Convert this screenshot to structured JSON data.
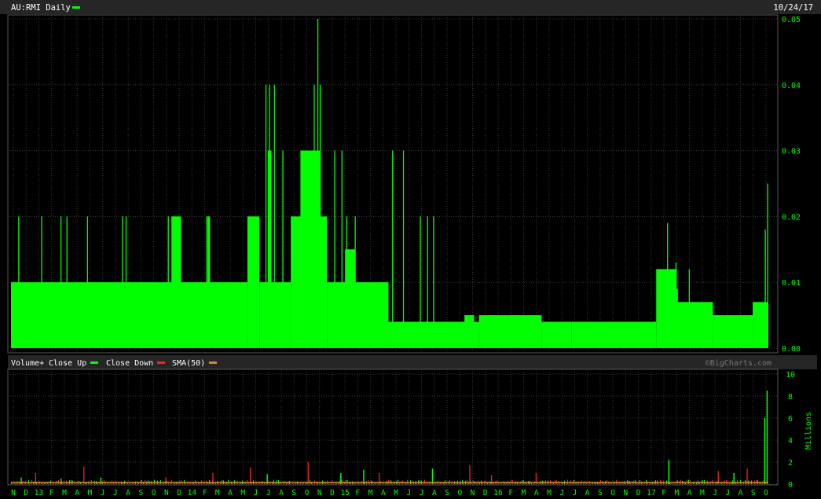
{
  "header": {
    "symbol_label": "AU:RMI Daily",
    "date": "10/24/17",
    "legend_color": "#00ff00"
  },
  "volume_header": {
    "label": "Volume+",
    "close_up_label": "Close Up",
    "close_down_label": "Close Down",
    "sma_label": "SMA(50)",
    "watermark": "©BigCharts.com",
    "up_color": "#00ff00",
    "down_color": "#ff2020",
    "sma_color": "#d08a2a"
  },
  "colors": {
    "background": "#000000",
    "grid": "#3a3a3a",
    "axis_text": "#00ff00",
    "frame": "#9a9a9a",
    "panel_bar": "#2e2e2e"
  },
  "chart_data": [
    {
      "type": "area",
      "name": "price",
      "yticks": [
        "0.05",
        "0.04",
        "0.03",
        "0.02",
        "0.01",
        "0.00"
      ],
      "ylim": [
        0,
        0.05
      ],
      "xlim": [
        0,
        62.8
      ],
      "grid": true,
      "baseline_segments": [
        [
          0,
          19.6,
          0.01
        ],
        [
          19.6,
          20.6,
          0.02
        ],
        [
          20.6,
          23.2,
          0.01
        ],
        [
          23.2,
          26.2,
          0.02
        ],
        [
          26.2,
          31.3,
          0.01
        ],
        [
          31.3,
          38.8,
          0.004
        ],
        [
          38.8,
          44.0,
          0.005
        ],
        [
          44.0,
          46.5,
          0.004
        ],
        [
          46.5,
          53.5,
          0.004
        ],
        [
          53.5,
          55.2,
          0.012
        ],
        [
          55.2,
          58.2,
          0.007
        ],
        [
          58.2,
          61.5,
          0.005
        ],
        [
          61.5,
          62.8,
          0.007
        ]
      ],
      "step_segments": [
        [
          13.3,
          14.1,
          0.02
        ],
        [
          16.3,
          16.5,
          0.02
        ],
        [
          21.3,
          21.6,
          0.03
        ],
        [
          24.0,
          25.6,
          0.03
        ],
        [
          27.7,
          28.5,
          0.015
        ],
        [
          30.8,
          31.3,
          0.006
        ],
        [
          37.6,
          38.4,
          0.005
        ],
        [
          54.5,
          55.3,
          0.009
        ]
      ],
      "spikes": [
        [
          0.6,
          0.02
        ],
        [
          2.5,
          0.02
        ],
        [
          4.1,
          0.02
        ],
        [
          4.6,
          0.02
        ],
        [
          6.3,
          0.02
        ],
        [
          9.2,
          0.02
        ],
        [
          9.5,
          0.02
        ],
        [
          13.0,
          0.02
        ],
        [
          16.2,
          0.02
        ],
        [
          21.1,
          0.04
        ],
        [
          21.4,
          0.04
        ],
        [
          21.8,
          0.04
        ],
        [
          22.5,
          0.03
        ],
        [
          24.2,
          0.03
        ],
        [
          25.1,
          0.04
        ],
        [
          25.4,
          0.05
        ],
        [
          25.6,
          0.04
        ],
        [
          26.8,
          0.03
        ],
        [
          27.4,
          0.03
        ],
        [
          27.8,
          0.02
        ],
        [
          28.5,
          0.02
        ],
        [
          31.6,
          0.03
        ],
        [
          32.5,
          0.03
        ],
        [
          33.9,
          0.02
        ],
        [
          34.5,
          0.02
        ],
        [
          35.0,
          0.02
        ],
        [
          54.4,
          0.019
        ],
        [
          55.1,
          0.013
        ],
        [
          56.2,
          0.012
        ],
        [
          62.5,
          0.018
        ],
        [
          62.7,
          0.025
        ]
      ]
    },
    {
      "type": "bar",
      "name": "volume",
      "ylabel": "Millions",
      "yticks": [
        "10",
        "8",
        "6",
        "4",
        "2",
        "0"
      ],
      "ylim": [
        0,
        10
      ],
      "xticks": [
        "N",
        "D",
        "13",
        "F",
        "M",
        "A",
        "M",
        "J",
        "J",
        "A",
        "S",
        "O",
        "N",
        "D",
        "14",
        "F",
        "M",
        "A",
        "M",
        "J",
        "J",
        "A",
        "S",
        "O",
        "N",
        "D",
        "15",
        "F",
        "M",
        "A",
        "M",
        "J",
        "J",
        "A",
        "S",
        "O",
        "N",
        "D",
        "16",
        "F",
        "M",
        "A",
        "M",
        "J",
        "J",
        "A",
        "S",
        "O",
        "N",
        "D",
        "17",
        "F",
        "M",
        "A",
        "M",
        "J",
        "J",
        "A",
        "S",
        "O"
      ],
      "down_spikes": [
        [
          2.0,
          1.0
        ],
        [
          6.0,
          1.6
        ],
        [
          12.8,
          0.6
        ],
        [
          16.7,
          1.0
        ],
        [
          19.8,
          1.5
        ],
        [
          24.6,
          2.0
        ],
        [
          30.5,
          1.0
        ],
        [
          38.0,
          1.7
        ],
        [
          39.8,
          0.8
        ],
        [
          43.5,
          1.0
        ],
        [
          58.6,
          1.2
        ],
        [
          61.0,
          1.4
        ]
      ],
      "up_spikes": [
        [
          0.8,
          0.6
        ],
        [
          4.1,
          0.5
        ],
        [
          7.4,
          0.6
        ],
        [
          21.2,
          0.9
        ],
        [
          27.3,
          1.0
        ],
        [
          29.2,
          1.3
        ],
        [
          34.9,
          1.4
        ],
        [
          51.2,
          0.3
        ],
        [
          54.5,
          2.2
        ],
        [
          59.9,
          1.0
        ],
        [
          62.45,
          6.0
        ],
        [
          62.65,
          8.5
        ]
      ],
      "sma_level": 0.15
    }
  ]
}
